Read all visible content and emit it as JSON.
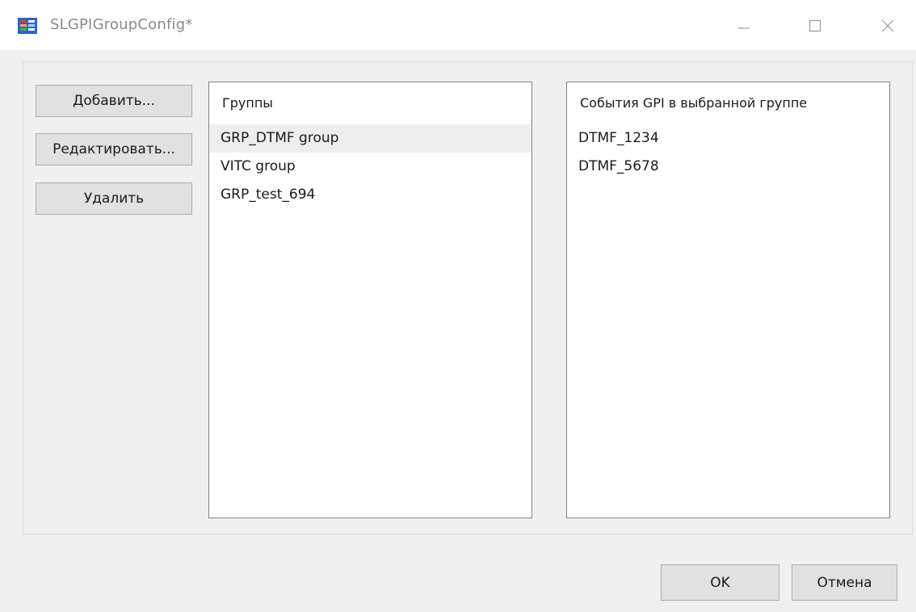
{
  "window": {
    "title": "SLGPIGroupConfig*",
    "icon": "app-icon"
  },
  "controls": {
    "minimize_icon": "minimize-icon",
    "maximize_icon": "maximize-icon",
    "close_icon": "close-icon"
  },
  "buttons": {
    "add": "Добавить...",
    "edit": "Редактировать...",
    "delete": "Удалить",
    "ok": "OK",
    "cancel": "Отмена"
  },
  "groups_list": {
    "header": "Группы",
    "items": [
      "GRP_DTMF group",
      "VITC group",
      "GRP_test_694"
    ],
    "selected_index": 0
  },
  "events_list": {
    "header": "События GPI в выбранной группе",
    "items": [
      "DTMF_1234",
      "DTMF_5678"
    ]
  },
  "colors": {
    "title_text": "#8a8a8a",
    "button_bg": "#e1e1e1",
    "selection_bg": "#eeeeee"
  }
}
